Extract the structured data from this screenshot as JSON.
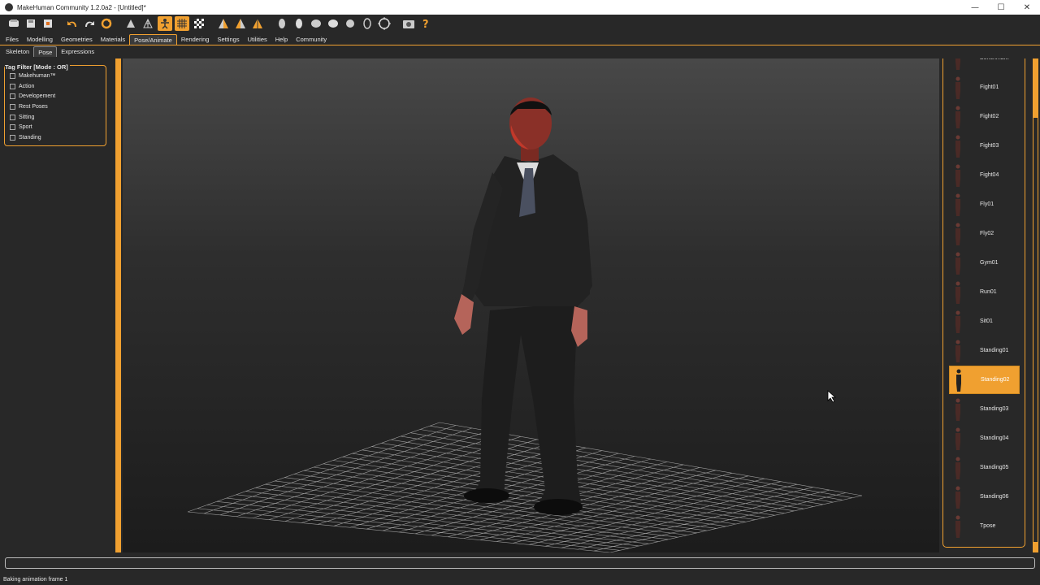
{
  "window": {
    "title": "MakeHuman Community 1.2.0a2 - [Untitled]*",
    "controls": [
      "minimize-icon",
      "maximize-icon",
      "close-icon"
    ]
  },
  "toolbar": {
    "icons": [
      "save-icon",
      "load-icon",
      "export-icon",
      "undo-icon",
      "redo-icon",
      "reset-icon",
      "smooth-icon",
      "wireframe-icon",
      "pose-icon",
      "grid-icon",
      "background-icon",
      "symmetry-right-icon",
      "symmetry-left-icon",
      "symmetry-icon",
      "front-view-icon",
      "back-view-icon",
      "left-view-icon",
      "right-view-icon",
      "top-view-icon",
      "bottom-view-icon",
      "reset-camera-icon",
      "screenshot-icon",
      "help-icon"
    ],
    "active": [
      "pose-icon",
      "grid-icon"
    ]
  },
  "main_tabs": [
    {
      "label": "Files",
      "active": false
    },
    {
      "label": "Modelling",
      "active": false
    },
    {
      "label": "Geometries",
      "active": false
    },
    {
      "label": "Materials",
      "active": false
    },
    {
      "label": "Pose/Animate",
      "active": true
    },
    {
      "label": "Rendering",
      "active": false
    },
    {
      "label": "Settings",
      "active": false
    },
    {
      "label": "Utilities",
      "active": false
    },
    {
      "label": "Help",
      "active": false
    },
    {
      "label": "Community",
      "active": false
    }
  ],
  "sub_tabs": [
    {
      "label": "Skeleton",
      "active": false
    },
    {
      "label": "Pose",
      "active": true
    },
    {
      "label": "Expressions",
      "active": false
    }
  ],
  "tag_filter": {
    "title": "Tag Filter [Mode : OR]",
    "items": [
      "Makehuman™",
      "Action",
      "Developement",
      "Rest Poses",
      "Sitting",
      "Sport",
      "Standing"
    ]
  },
  "poses": [
    {
      "label": "Benchmark",
      "selected": false
    },
    {
      "label": "Fight01",
      "selected": false
    },
    {
      "label": "Fight02",
      "selected": false
    },
    {
      "label": "Fight03",
      "selected": false
    },
    {
      "label": "Fight04",
      "selected": false
    },
    {
      "label": "Fly01",
      "selected": false
    },
    {
      "label": "Fly02",
      "selected": false
    },
    {
      "label": "Gym01",
      "selected": false
    },
    {
      "label": "Run01",
      "selected": false
    },
    {
      "label": "Sit01",
      "selected": false
    },
    {
      "label": "Standing01",
      "selected": false
    },
    {
      "label": "Standing02",
      "selected": true
    },
    {
      "label": "Standing03",
      "selected": false
    },
    {
      "label": "Standing04",
      "selected": false
    },
    {
      "label": "Standing05",
      "selected": false
    },
    {
      "label": "Standing06",
      "selected": false
    },
    {
      "label": "Tpose",
      "selected": false
    }
  ],
  "status": {
    "text": "Baking animation frame 1"
  },
  "colors": {
    "accent": "#f0a030",
    "background": "#282828"
  }
}
